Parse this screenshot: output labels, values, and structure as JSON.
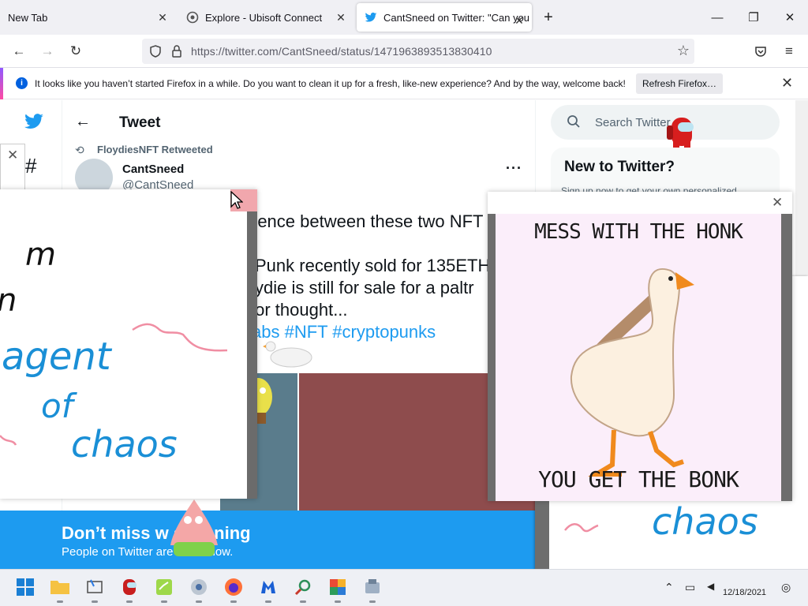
{
  "browser": {
    "tabs": [
      {
        "title": "New Tab"
      },
      {
        "title": "Explore - Ubisoft Connect"
      },
      {
        "title": "CantSneed on Twitter: \"Can you"
      }
    ],
    "url": "https://twitter.com/CantSneed/status/1471963893513830410",
    "infobar": {
      "message": "It looks like you haven’t started Firefox in a while. Do you want to clean it up for a fresh, like-new experience? And by the way, welcome back!",
      "button": "Refresh Firefox…"
    }
  },
  "twitter": {
    "header": "Tweet",
    "retweeted_by": "FloydiesNFT Retweeted",
    "author_name": "CantSneed",
    "author_handle": "@CantSneed",
    "text_lines": [
      "rence between these two NFT",
      "Punk recently sold for 135ETH",
      "ydie is still for sale for a paltr",
      " for thought..."
    ],
    "hashtags": "abs #NFT #cryptopunks",
    "search_placeholder": "Search Twitter",
    "new_to_twitter": "New to Twitter?",
    "new_to_twitter_sub": "Sign up now to get your own personalized",
    "banner_title": "Don’t miss w         appening",
    "banner_sub": "People on Twitter are t         t to know."
  },
  "overlays": {
    "scribble_words": [
      "m",
      "n",
      "agent",
      "of",
      "chaos"
    ],
    "meme_top": "MESS WITH THE HONK",
    "meme_bottom": "YOU GET THE BONK",
    "right_scribble": "chaos"
  },
  "taskbar": {
    "date": "12/18/2021"
  },
  "colors": {
    "twitter_blue": "#1d9bf0",
    "meme_bg": "#fbeefa",
    "maroon": "#8e4c4d"
  }
}
